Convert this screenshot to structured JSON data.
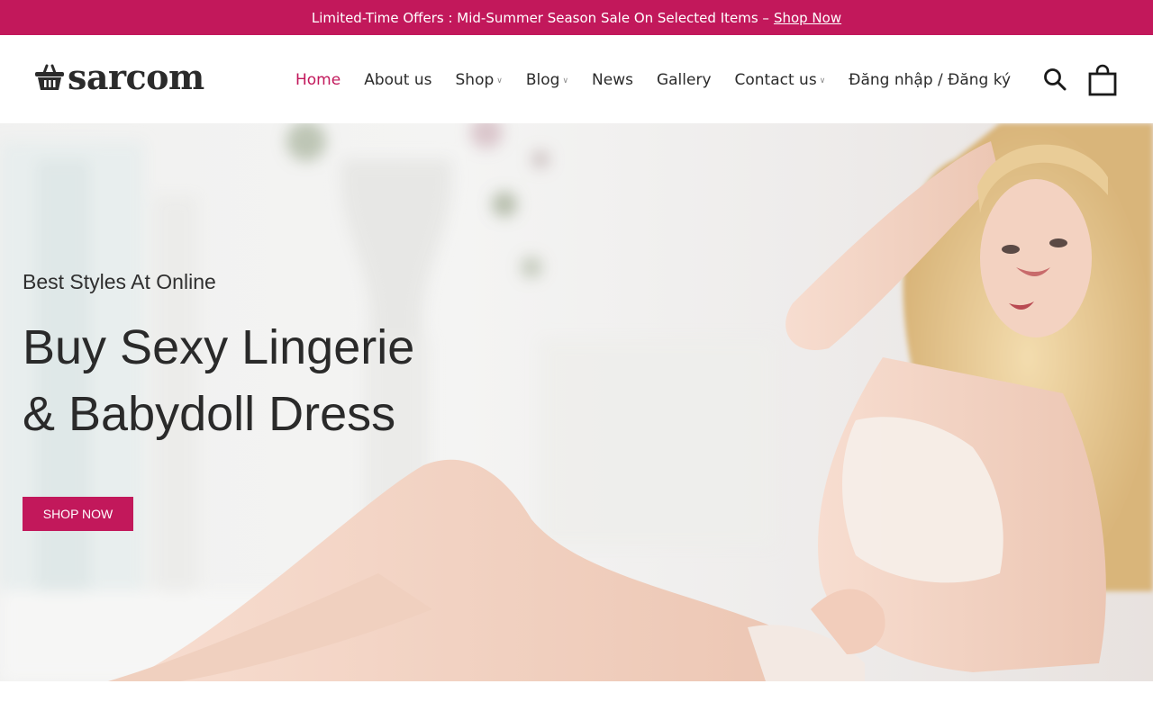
{
  "promo": {
    "text": "Limited-Time Offers : Mid-Summer Season Sale On Selected Items –",
    "link": "Shop Now"
  },
  "brand": {
    "name": "sarcom",
    "icon": "basket-icon"
  },
  "nav": {
    "items": [
      {
        "label": "Home",
        "active": true,
        "dropdown": false
      },
      {
        "label": "About us",
        "active": false,
        "dropdown": false
      },
      {
        "label": "Shop",
        "active": false,
        "dropdown": true
      },
      {
        "label": "Blog",
        "active": false,
        "dropdown": true
      },
      {
        "label": "News",
        "active": false,
        "dropdown": false
      },
      {
        "label": "Gallery",
        "active": false,
        "dropdown": false
      },
      {
        "label": "Contact us",
        "active": false,
        "dropdown": true
      },
      {
        "label": "Đăng nhập / Đăng ký",
        "active": false,
        "dropdown": false
      }
    ],
    "search_icon": "search-icon",
    "cart_icon": "shopping-bag-icon"
  },
  "hero": {
    "subtitle": "Best Styles At Online",
    "title_line1": "Buy Sexy Lingerie",
    "title_line2": "& Babydoll Dress",
    "button": "SHOP NOW"
  },
  "colors": {
    "accent": "#c2185b",
    "text": "#2b2b2b"
  }
}
